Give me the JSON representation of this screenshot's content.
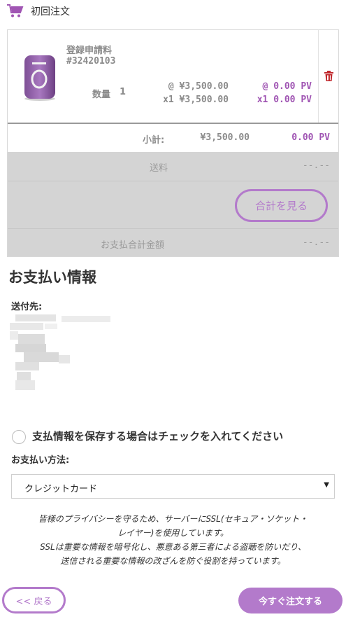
{
  "header": {
    "title": "初回注文",
    "icon": "cart-icon"
  },
  "order": {
    "item": {
      "name": "登録申請料",
      "sku": "#32420103",
      "qty_label": "数量",
      "qty": "1",
      "unit_price": "@ ¥3,500.00",
      "total_price": "x1 ¥3,500.00",
      "unit_pv": "@ 0.00 PV",
      "total_pv": "x1 0.00 PV"
    },
    "subtotal": {
      "label": "小計:",
      "price": "¥3,500.00",
      "pv": "0.00 PV"
    },
    "shipping": {
      "label": "送料",
      "value": "--.--"
    },
    "calc_button": "合計を見る",
    "grand_total": {
      "label": "お支払合計金額",
      "value": "--.--"
    }
  },
  "payment": {
    "title": "お支払い情報",
    "ship_to_label": "送付先:",
    "save_label": "支払情報を保存する場合はチェックを入れてください",
    "method_label": "お支払い方法:",
    "method_value": "クレジットカード",
    "ssl_note": [
      "皆様のプライバシーを守るため、サーバーにSSL(セキュア・ソケット・",
      "レイヤー)を使用しています。",
      "SSLは重要な情報を暗号化し、悪意ある第三者による盗聴を防いだり、",
      "送信される重要な情報の改ざんを防ぐ役割を持っています。"
    ]
  },
  "buttons": {
    "back": "<< 戻る",
    "order_now": "今すぐ注文する"
  },
  "colors": {
    "accent": "#b37acb",
    "pv": "#a055b3",
    "delete": "#c0282d",
    "grey_panel": "#d4d4d4"
  }
}
